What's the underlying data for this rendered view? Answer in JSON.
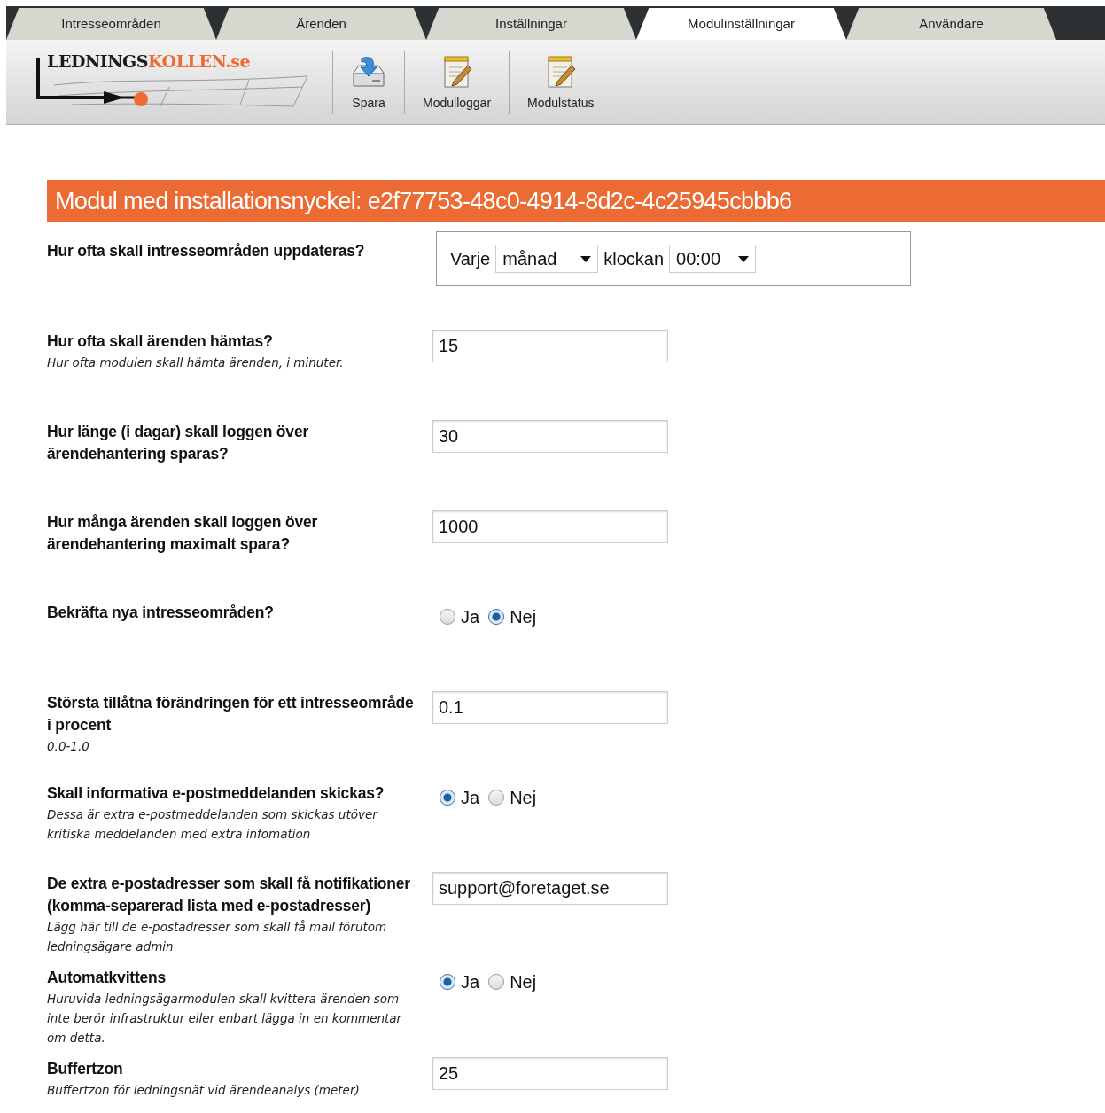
{
  "tabs": [
    {
      "label": "Intresseområden",
      "selected": false
    },
    {
      "label": "Ärenden",
      "selected": false
    },
    {
      "label": "Inställningar",
      "selected": false
    },
    {
      "label": "Modulinställningar",
      "selected": true
    },
    {
      "label": "Användare",
      "selected": false
    }
  ],
  "logo": {
    "part1": "LEDNINGS",
    "part2": "KOLLEN.se"
  },
  "toolbar": [
    {
      "label": "Spara",
      "kind": "save"
    },
    {
      "label": "Modulloggar",
      "kind": "notepad"
    },
    {
      "label": "Modulstatus",
      "kind": "notepad"
    }
  ],
  "panel_title": "Modul med installationsnyckel: e2f77753-48c0-4914-8d2c-4c25945cbbb6",
  "settings": [
    {
      "kind": "schedule",
      "label": "Hur ofta skall intresseområden uppdateras?",
      "prefix": "Varje",
      "period": "månad",
      "between": "klockan",
      "time": "00:00"
    },
    {
      "kind": "text",
      "label": "Hur ofta skall ärenden hämtas?",
      "hint": "Hur ofta modulen skall hämta ärenden, i minuter.",
      "value": "15"
    },
    {
      "kind": "text",
      "label": "Hur länge (i dagar) skall loggen över ärendehantering sparas?",
      "value": "30"
    },
    {
      "kind": "text",
      "label": "Hur många ärenden skall loggen över ärendehantering maximalt spara?",
      "value": "1000"
    },
    {
      "kind": "radio",
      "label": "Bekräfta nya intresseområden?",
      "options": [
        {
          "label": "Ja",
          "selected": false
        },
        {
          "label": "Nej",
          "selected": true
        }
      ]
    },
    {
      "kind": "text",
      "label": "Största tillåtna förändringen för ett intresseområde i procent",
      "hint": "0.0-1.0",
      "value": "0.1"
    },
    {
      "kind": "radio",
      "label": "Skall informativa e-postmeddelanden skickas?",
      "hint": "Dessa är extra e-postmeddelanden som skickas utöver kritiska meddelanden med extra infomation",
      "options": [
        {
          "label": "Ja",
          "selected": true
        },
        {
          "label": "Nej",
          "selected": false
        }
      ]
    },
    {
      "kind": "text",
      "label": "De extra e-postadresser som skall få notifikationer (komma-separerad lista med e-postadresser)",
      "hint": "Lägg här till de e-postadresser som skall få mail förutom ledningsägare admin",
      "value": "support@foretaget.se"
    },
    {
      "kind": "radio",
      "label": "Automatkvittens",
      "hint": "Huruvida ledningsägarmodulen skall kvittera ärenden som inte berör infrastruktur eller enbart lägga in en kommentar om detta.",
      "options": [
        {
          "label": "Ja",
          "selected": true
        },
        {
          "label": "Nej",
          "selected": false
        }
      ]
    },
    {
      "kind": "text",
      "label": "Buffertzon",
      "hint": "Buffertzon för ledningsnät vid ärendeanalys (meter)",
      "value": "25"
    }
  ]
}
